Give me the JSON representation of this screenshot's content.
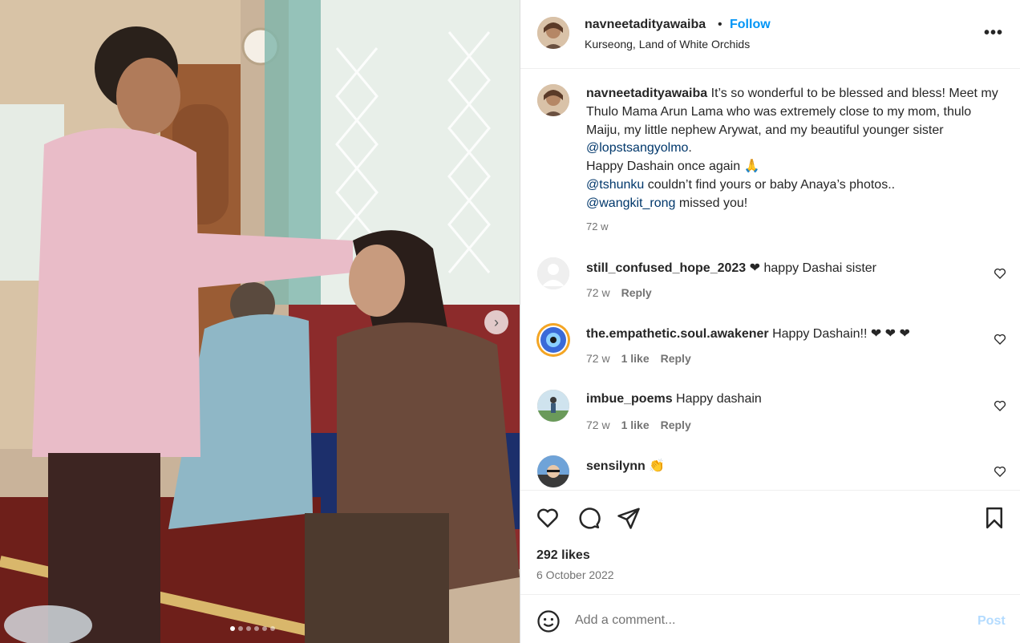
{
  "header": {
    "username": "navneetadityawaiba",
    "bullet": "•",
    "follow_label": "Follow",
    "location": "Kurseong, Land of White Orchids",
    "more_icon": "more-options-icon"
  },
  "caption": {
    "username": "navneetadityawaiba",
    "text_1": "It’s so wonderful to be blessed and bless! Meet my Thulo Mama Arun Lama who was extremely close to my mom, thulo Maiju, my little nephew Arywat, and my beautiful younger sister",
    "mention_1": "@lopstsangyolmo",
    "text_2": ".",
    "line_dashain": "Happy Dashain once again 🙏",
    "mention_2": "@tshunku",
    "text_3": "couldn’t find yours or baby Anaya’s photos..",
    "mention_3": "@wangkit_rong",
    "text_4": "missed you!",
    "time": "72 w"
  },
  "comments": [
    {
      "username": "still_confused_hope_2023",
      "text": "❤ happy Dashai sister",
      "time": "72 w",
      "likes": "",
      "reply": "Reply"
    },
    {
      "username": "the.empathetic.soul.awakener",
      "text": "Happy Dashain!! ❤ ❤ ❤",
      "time": "72 w",
      "likes": "1 like",
      "reply": "Reply"
    },
    {
      "username": "imbue_poems",
      "text": "Happy dashain",
      "time": "72 w",
      "likes": "1 like",
      "reply": "Reply"
    },
    {
      "username": "sensilynn",
      "text": "👏",
      "time": "",
      "likes": "",
      "reply": ""
    }
  ],
  "actions": {
    "like_icon": "heart-icon",
    "comment_icon": "comment-icon",
    "share_icon": "share-icon",
    "save_icon": "bookmark-icon",
    "likes": "292 likes",
    "date": "6 October 2022"
  },
  "comment_bar": {
    "placeholder": "Add a comment...",
    "post_label": "Post"
  },
  "carousel": {
    "next_label": "›",
    "slide_count": 6,
    "active_slide": 1
  },
  "colors": {
    "link": "#0095f6",
    "mention": "#00376b",
    "muted": "#737373",
    "heart": "#e0245e"
  }
}
